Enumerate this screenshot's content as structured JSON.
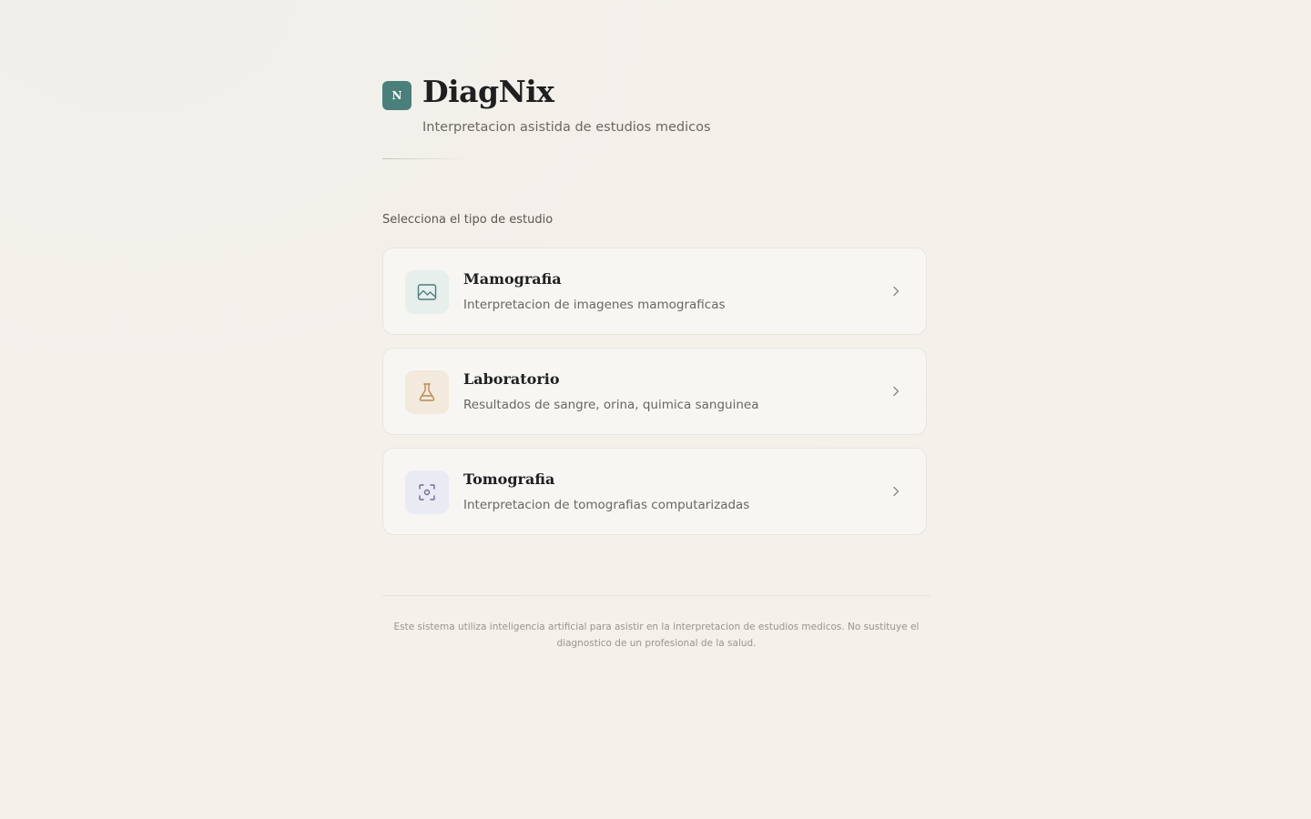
{
  "brand": {
    "logo_letter": "N",
    "name": "DiagNix",
    "tagline": "Interpretacion asistida de estudios medicos"
  },
  "section_label": "Selecciona el tipo de estudio",
  "study_types": [
    {
      "title": "Mamografia",
      "description": "Interpretacion de imagenes mamograficas",
      "icon": "image-icon",
      "icon_bg": "#e6efec",
      "icon_color": "#4a7f7c"
    },
    {
      "title": "Laboratorio",
      "description": "Resultados de sangre, orina, quimica sanguinea",
      "icon": "flask-icon",
      "icon_bg": "#f3e9dc",
      "icon_color": "#b98a55"
    },
    {
      "title": "Tomografia",
      "description": "Interpretacion de tomografias computarizadas",
      "icon": "scan-icon",
      "icon_bg": "#e9eaf4",
      "icon_color": "#6b6f93"
    }
  ],
  "disclaimer": "Este sistema utiliza inteligencia artificial para asistir en la interpretacion de estudios medicos. No sustituye el diagnostico de un profesional de la salud.",
  "colors": {
    "brand": "#4a7f7c",
    "background": "#f4f1eb",
    "card": "#f8f6f2"
  }
}
